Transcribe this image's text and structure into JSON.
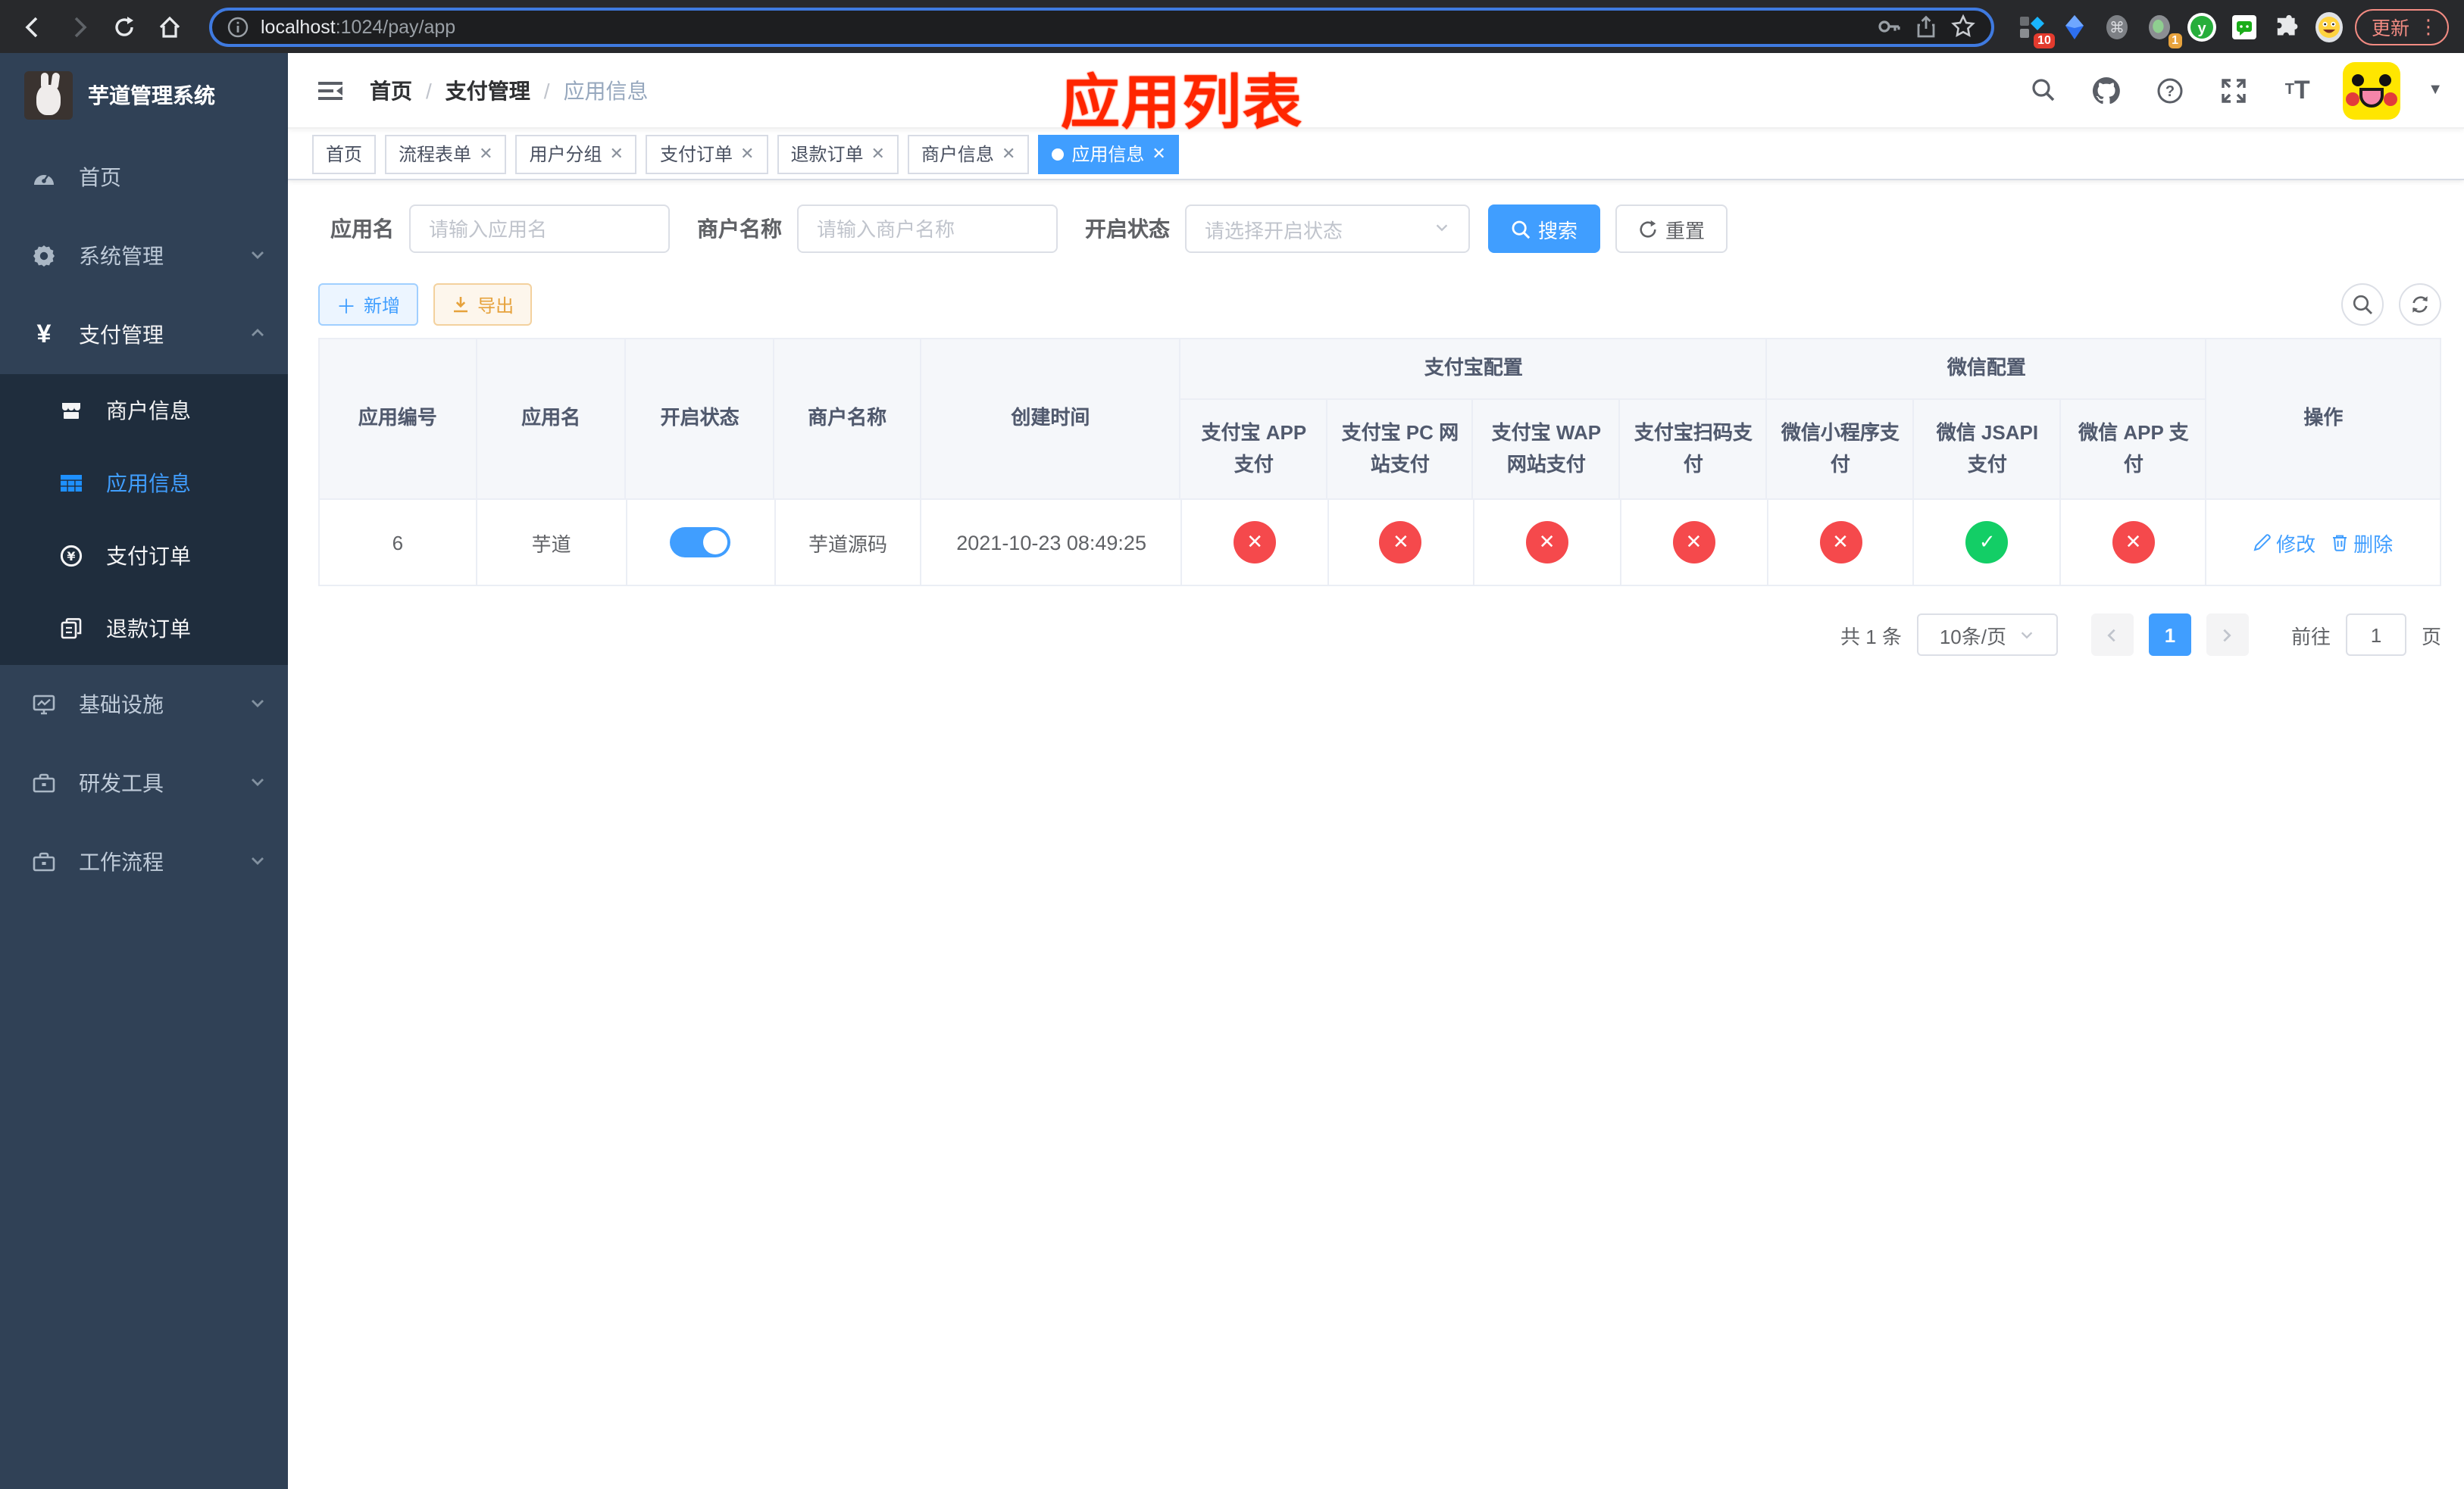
{
  "colors": {
    "primary": "#409eff",
    "danger": "#f5494c",
    "success": "#13ce66",
    "warning": "#e6a23c",
    "annotation": "#ff2600"
  },
  "browser": {
    "url_host": "localhost",
    "url_rest": ":1024/pay/app",
    "update_label": "更新",
    "ext_badge_ten": "10",
    "ext_badge_one": "1"
  },
  "annotation": {
    "title": "应用列表"
  },
  "sidebar": {
    "title": "芋道管理系统",
    "items": [
      {
        "label": "首页"
      },
      {
        "label": "系统管理"
      },
      {
        "label": "支付管理"
      },
      {
        "label": "商户信息"
      },
      {
        "label": "应用信息"
      },
      {
        "label": "支付订单"
      },
      {
        "label": "退款订单"
      },
      {
        "label": "基础设施"
      },
      {
        "label": "研发工具"
      },
      {
        "label": "工作流程"
      }
    ]
  },
  "navbar": {
    "breadcrumb": {
      "home": "首页",
      "section": "支付管理",
      "current": "应用信息"
    }
  },
  "tabs": [
    {
      "label": "首页"
    },
    {
      "label": "流程表单"
    },
    {
      "label": "用户分组"
    },
    {
      "label": "支付订单"
    },
    {
      "label": "退款订单"
    },
    {
      "label": "商户信息"
    },
    {
      "label": "应用信息"
    }
  ],
  "filters": {
    "app_name_label": "应用名",
    "app_name_placeholder": "请输入应用名",
    "merchant_label": "商户名称",
    "merchant_placeholder": "请输入商户名称",
    "status_label": "开启状态",
    "status_placeholder": "请选择开启状态",
    "search_label": "搜索",
    "reset_label": "重置"
  },
  "toolbar": {
    "add_label": "新增",
    "export_label": "导出"
  },
  "table": {
    "headers": {
      "id": "应用编号",
      "name": "应用名",
      "status": "开启状态",
      "merchant": "商户名称",
      "created": "创建时间",
      "alipay_group": "支付宝配置",
      "wechat_group": "微信配置",
      "alipay_app": "支付宝 APP 支付",
      "alipay_pc": "支付宝 PC 网站支付",
      "alipay_wap": "支付宝 WAP 网站支付",
      "alipay_qr": "支付宝扫码支付",
      "wx_lite": "微信小程序支付",
      "wx_jsapi": "微信 JSAPI 支付",
      "wx_app": "微信 APP 支付",
      "actions": "操作"
    },
    "icons": {
      "fail": "✕",
      "success": "✓"
    },
    "row": {
      "id": "6",
      "name": "芋道",
      "merchant": "芋道源码",
      "created": "2021-10-23 08:49:25",
      "edit_label": "修改",
      "delete_label": "删除"
    }
  },
  "pagination": {
    "total": "共 1 条",
    "page_size": "10条/页",
    "current_page": "1",
    "goto_label": "前往",
    "goto_value": "1",
    "unit_label": "页"
  }
}
